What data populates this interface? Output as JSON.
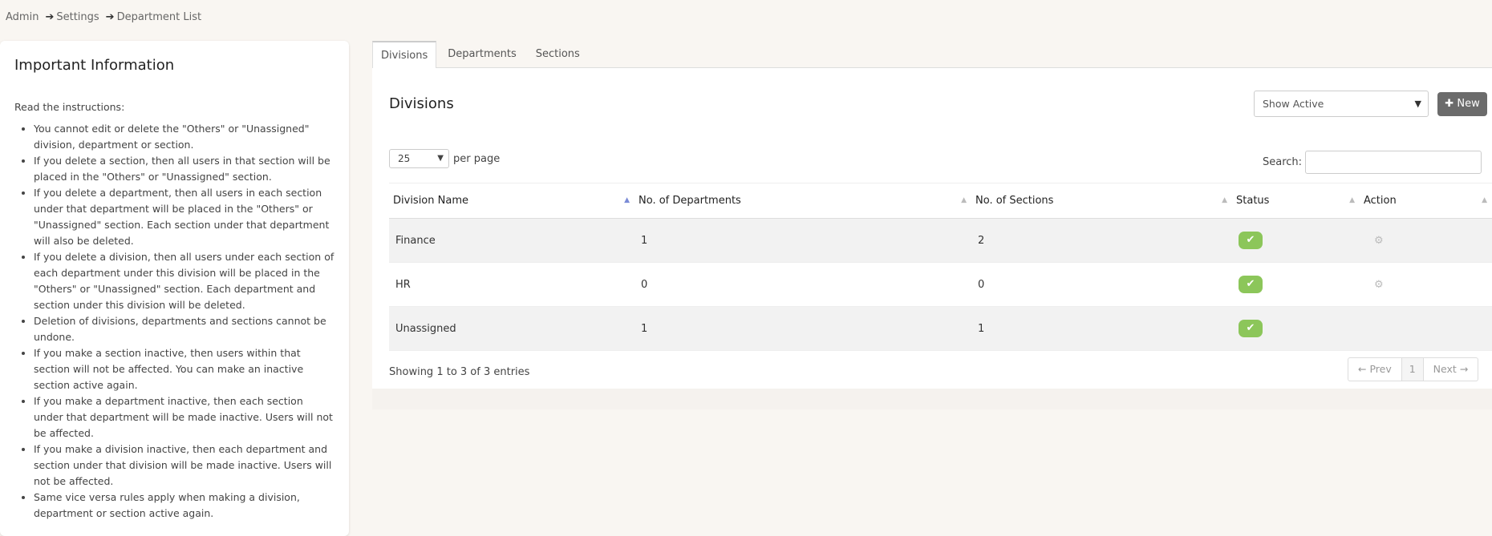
{
  "breadcrumb": [
    "Admin",
    "Settings",
    "Department List"
  ],
  "info": {
    "title": "Important Information",
    "intro": "Read the instructions:",
    "items": [
      "You cannot edit or delete the \"Others\" or \"Unassigned\" division, department or section.",
      "If you delete a section, then all users in that section will be placed in the \"Others\" or \"Unassigned\" section.",
      "If you delete a department, then all users in each section under that department will be placed in the \"Others\" or \"Unassigned\" section. Each section under that department will also be deleted.",
      "If you delete a division, then all users under each section of each department under this division will be placed in the \"Others\" or \"Unassigned\" section. Each department and section under this division will be deleted.",
      "Deletion of divisions, departments and sections cannot be undone.",
      "If you make a section inactive, then users within that section will not be affected. You can make an inactive section active again.",
      "If you make a department inactive, then each section under that department will be made inactive. Users will not be affected.",
      "If you make a division inactive, then each department and section under that division will be made inactive. Users will not be affected.",
      "Same vice versa rules apply when making a division, department or section active again."
    ]
  },
  "tabs": [
    "Divisions",
    "Departments",
    "Sections"
  ],
  "card": {
    "title": "Divisions",
    "status_filter": "Show Active",
    "new_label": "New",
    "per_page_value": "25",
    "per_page_label": "per page",
    "search_label": "Search:"
  },
  "table": {
    "headers": [
      "Division Name",
      "No. of Departments",
      "No. of Sections",
      "Status",
      "Action"
    ],
    "rows": [
      {
        "name": "Finance",
        "departments": "1",
        "sections": "2",
        "active": true,
        "action": true
      },
      {
        "name": "HR",
        "departments": "0",
        "sections": "0",
        "active": true,
        "action": true
      },
      {
        "name": "Unassigned",
        "departments": "1",
        "sections": "1",
        "active": true,
        "action": false
      }
    ]
  },
  "footer": {
    "showing": "Showing 1 to 3 of 3 entries",
    "prev": "← Prev",
    "page": "1",
    "next": "Next →"
  },
  "colors": {
    "active_badge": "#8cc65a",
    "new_button": "#6b6b6b"
  }
}
